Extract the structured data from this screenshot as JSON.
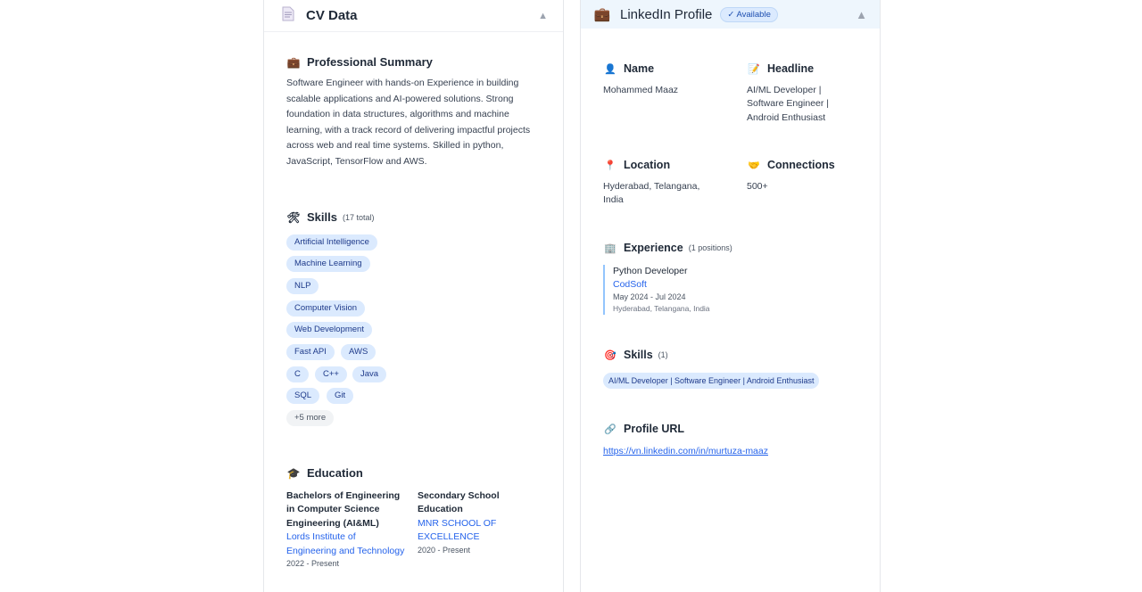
{
  "cv": {
    "title": "CV Data",
    "header_icon": "document-icon",
    "summary": {
      "title": "Professional Summary",
      "text": "Software Engineer with hands-on Experience in building scalable applications and AI-powered solutions. Strong foundation in data structures, algorithms and machine learning, with a track record of delivering impactful projects across web and real time systems. Skilled in python, JavaScript, TensorFlow and AWS."
    },
    "skills": {
      "title": "Skills",
      "count": "(17 total)",
      "items": [
        "Artificial Intelligence",
        "Machine Learning",
        "NLP",
        "Computer Vision",
        "Web Development",
        "Fast API",
        "AWS",
        "C",
        "C++",
        "Java",
        "SQL",
        "Git"
      ],
      "more": "+5 more"
    },
    "education": {
      "title": "Education",
      "entries": [
        {
          "degree": "Bachelors of Engineering in Computer Science Engineering (AI&ML)",
          "school": "Lords Institute of Engineering and Technology",
          "years": "2022 - Present"
        },
        {
          "degree": "Secondary School Education",
          "school": "MNR SCHOOL OF EXCELLENCE",
          "years": "2020 - Present"
        }
      ]
    }
  },
  "linkedin": {
    "title": "LinkedIn Profile",
    "badge": "✓ Available",
    "header_icon": "briefcase-icon",
    "name": {
      "label": "Name",
      "value": "Mohammed Maaz"
    },
    "headline": {
      "label": "Headline",
      "value": "AI/ML Developer | Software Engineer | Android Enthusiast"
    },
    "location": {
      "label": "Location",
      "value": "Hyderabad, Telangana, India"
    },
    "connections": {
      "label": "Connections",
      "value": "500+"
    },
    "experience": {
      "title": "Experience",
      "count": "(1 positions)",
      "entries": [
        {
          "title": "Python Developer",
          "company": "CodSoft",
          "dates": "May 2024 - Jul 2024",
          "location": "Hyderabad, Telangana, India"
        }
      ]
    },
    "skills": {
      "title": "Skills",
      "count": "(1)",
      "items": [
        "AI/ML Developer | Software Engineer | Android Enthusiast"
      ]
    },
    "profile_url": {
      "label": "Profile URL",
      "value": "https://vn.linkedin.com/in/murtuza-maaz"
    }
  }
}
